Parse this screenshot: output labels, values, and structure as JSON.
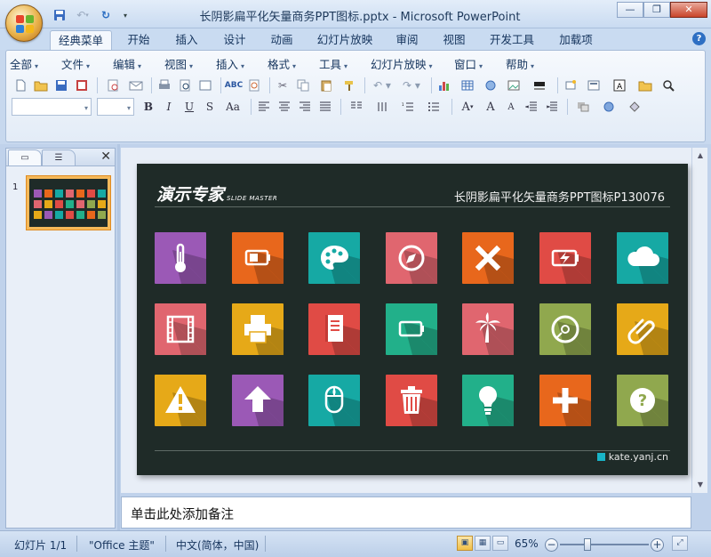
{
  "window": {
    "title": "长阴影扁平化矢量商务PPT图标.pptx - Microsoft PowerPoint",
    "minimize": "—",
    "restore": "❐",
    "close": "✕"
  },
  "tabs": [
    {
      "label": "经典菜单",
      "active": true
    },
    {
      "label": "开始"
    },
    {
      "label": "插入"
    },
    {
      "label": "设计"
    },
    {
      "label": "动画"
    },
    {
      "label": "幻灯片放映"
    },
    {
      "label": "审阅"
    },
    {
      "label": "视图"
    },
    {
      "label": "开发工具"
    },
    {
      "label": "加载项"
    }
  ],
  "help": "?",
  "menus": [
    "全部",
    "文件",
    "编辑",
    "视图",
    "插入",
    "格式",
    "工具",
    "幻灯片放映",
    "窗口",
    "帮助"
  ],
  "format_buttons": [
    "B",
    "I",
    "U",
    "S",
    "Aa"
  ],
  "sidebar": {
    "slide_number": "1"
  },
  "slide": {
    "brand": "演示专家",
    "brand_sub": "SLIDE MASTER",
    "title": "长阴影扁平化矢量商务PPT图标P130076",
    "footer": "kate.yanj.cn",
    "icons": [
      {
        "name": "thermometer-icon",
        "color": "#9b59b6"
      },
      {
        "name": "battery-icon",
        "color": "#e8671c"
      },
      {
        "name": "palette-icon",
        "color": "#16a9a4"
      },
      {
        "name": "compass-icon",
        "color": "#e0666f"
      },
      {
        "name": "close-x-icon",
        "color": "#e8671c"
      },
      {
        "name": "battery-charging-icon",
        "color": "#e04b45"
      },
      {
        "name": "cloud-icon",
        "color": "#16a9a4"
      },
      {
        "name": "film-icon",
        "color": "#e0666f"
      },
      {
        "name": "printer-icon",
        "color": "#e6a918"
      },
      {
        "name": "notebook-icon",
        "color": "#e04b45"
      },
      {
        "name": "battery-empty-icon",
        "color": "#22b08a"
      },
      {
        "name": "palm-tree-icon",
        "color": "#e0666f"
      },
      {
        "name": "disc-icon",
        "color": "#90a84e"
      },
      {
        "name": "paperclip-icon",
        "color": "#e6a918"
      },
      {
        "name": "warning-icon",
        "color": "#e6a918"
      },
      {
        "name": "upload-arrow-icon",
        "color": "#9b59b6"
      },
      {
        "name": "mouse-icon",
        "color": "#16a9a4"
      },
      {
        "name": "trash-icon",
        "color": "#e04b45"
      },
      {
        "name": "lightbulb-icon",
        "color": "#22b08a"
      },
      {
        "name": "plus-icon",
        "color": "#e8671c"
      },
      {
        "name": "help-question-icon",
        "color": "#90a84e"
      }
    ]
  },
  "notes": {
    "placeholder": "单击此处添加备注"
  },
  "status": {
    "slide_info": "幻灯片 1/1",
    "theme": "\"Office 主题\"",
    "language": "中文(简体，中国)",
    "zoom": "65%"
  }
}
